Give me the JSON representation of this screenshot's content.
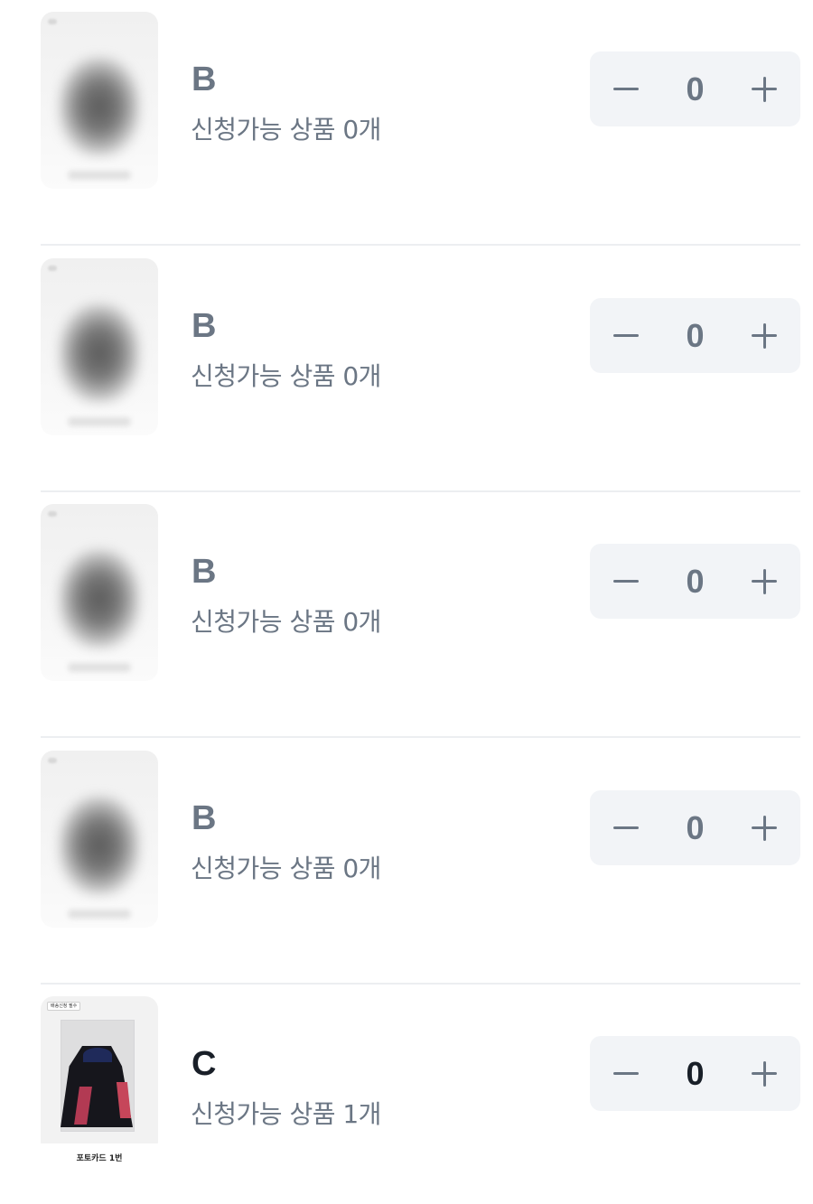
{
  "items": [
    {
      "grade": "B",
      "available_label": "신청가능 상품 0개",
      "quantity": "0",
      "image": "blurred"
    },
    {
      "grade": "B",
      "available_label": "신청가능 상품 0개",
      "quantity": "0",
      "image": "blurred"
    },
    {
      "grade": "B",
      "available_label": "신청가능 상품 0개",
      "quantity": "0",
      "image": "blurred"
    },
    {
      "grade": "B",
      "available_label": "신청가능 상품 0개",
      "quantity": "0",
      "image": "blurred"
    },
    {
      "grade": "C",
      "available_label": "신청가능 상품 1개",
      "quantity": "0",
      "image": "photocard",
      "image_tag": "배송신청 필수",
      "image_caption": "포토카드 1번"
    }
  ],
  "icons": {
    "decrement": "minus-icon",
    "increment": "plus-icon"
  },
  "colors": {
    "muted_text": "#6b7684",
    "active_text": "#191f28",
    "stepper_bg": "#f2f4f7",
    "divider": "#eceef1"
  }
}
